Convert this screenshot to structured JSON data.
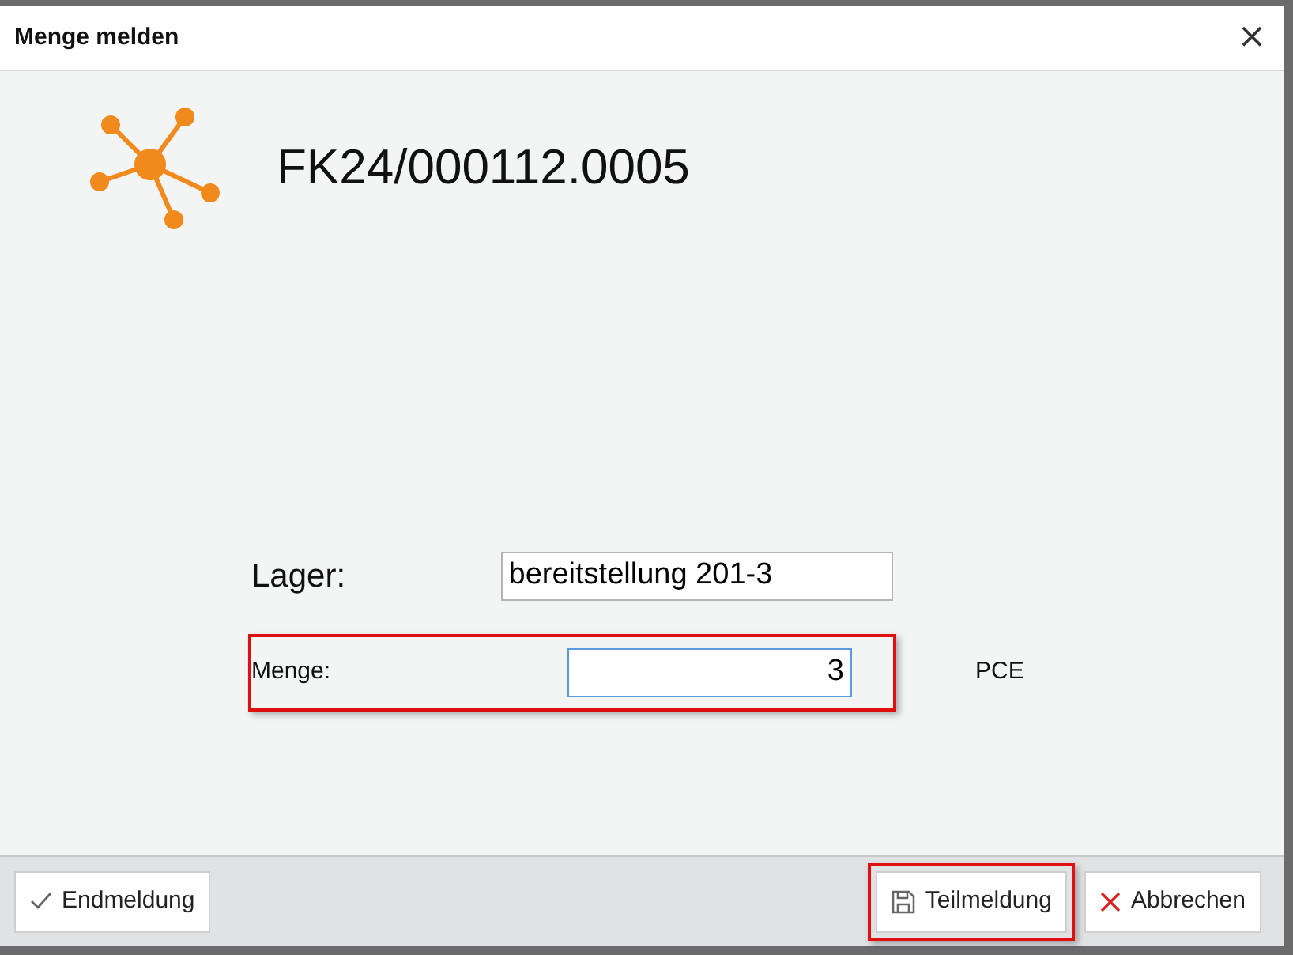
{
  "window": {
    "title": "Menge melden",
    "close": "×"
  },
  "header": {
    "title": "FK24/000112.0005"
  },
  "form": [
    {
      "kind": "large",
      "label": "Lager:",
      "value": "bereitstellung 201-3",
      "focused": false,
      "highlighted": false
    },
    {
      "kind": "small",
      "label": "Menge:",
      "value": "3",
      "unit": "PCE",
      "focused": true,
      "highlighted": true
    }
  ],
  "buttons": [
    {
      "kind": "check",
      "label": "Endmeldung",
      "highlighted": false
    },
    {
      "kind": "save",
      "label": "Teilmeldung",
      "highlighted": true
    },
    {
      "kind": "cancel",
      "label": "Abbrechen",
      "highlighted": false
    }
  ]
}
